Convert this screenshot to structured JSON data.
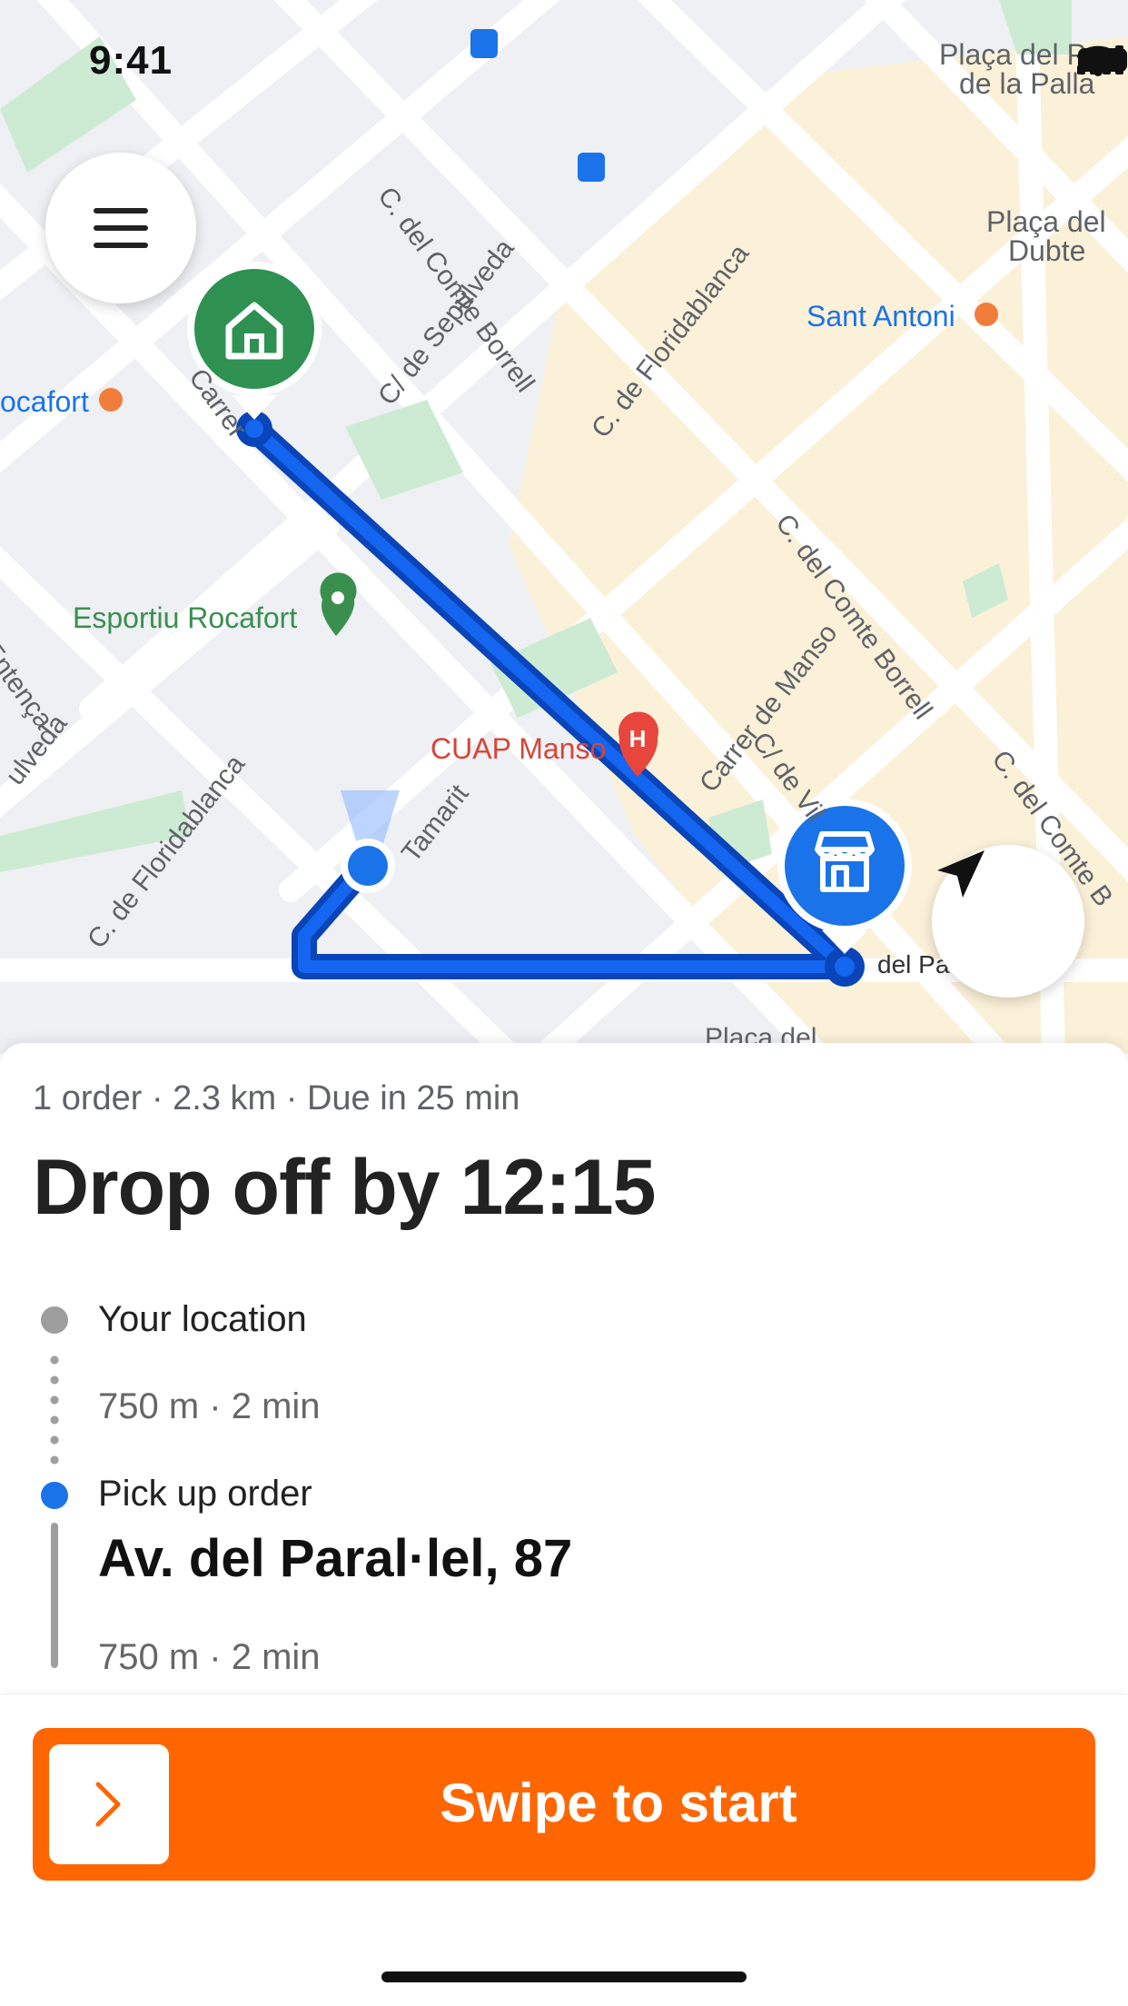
{
  "status_bar": {
    "time": "9:41"
  },
  "map": {
    "streets": [
      {
        "label": "C. del Comte Borrell"
      },
      {
        "label": "C/ de Sepúlveda"
      },
      {
        "label": "C. de Floridablanca"
      },
      {
        "label": "C. del Comte Borrell"
      },
      {
        "label": "Carrer de Manso"
      },
      {
        "label": "C. de Floridablanca"
      },
      {
        "label": "Tamarit"
      },
      {
        "label": "Entença"
      },
      {
        "label": "ulveda"
      },
      {
        "label": "Carrer"
      },
      {
        "label": "C/ de Vil"
      },
      {
        "label": "C. del Comte B"
      }
    ],
    "places": {
      "esportiu": "Esportiu Rocafort",
      "cuap": "CUAP Manso",
      "sant_antoni": "Sant Antoni",
      "rocafort": "ocafort",
      "placa_dubte_1": "Plaça del",
      "placa_dubte_2": "Dubte",
      "pes_palla_1": "Plaça del Pes",
      "pes_palla_2": "de la Palla",
      "del_pa": "del Pa",
      "placa_del": "Plaça del"
    },
    "colors": {
      "route": "#0a5ee0",
      "home_pin": "#2e9152",
      "store_pin": "#1a73e8",
      "park_label": "#3a8f4f",
      "metro_label": "#1a73e8",
      "hospital": "#e8453c"
    }
  },
  "sheet": {
    "summary": "1 order · 2.3 km · Due in 25 min",
    "headline": "Drop off by 12:15",
    "stops": [
      {
        "label": "Your location",
        "meta": "750 m · 2 min"
      },
      {
        "label": "Pick up order",
        "address": "Av. del Paral·lel, 87",
        "meta": "750 m · 2 min"
      }
    ]
  },
  "footer": {
    "swipe_label": "Swipe to start",
    "accent": "#ff6600"
  },
  "icons": [
    "menu-icon",
    "home-icon",
    "store-icon",
    "navigation-arrow-icon",
    "chevron-right-icon",
    "signal-icon",
    "wifi-icon",
    "battery-icon",
    "bus-stop-icon",
    "metro-icon",
    "hospital-icon",
    "park-pin-icon"
  ]
}
